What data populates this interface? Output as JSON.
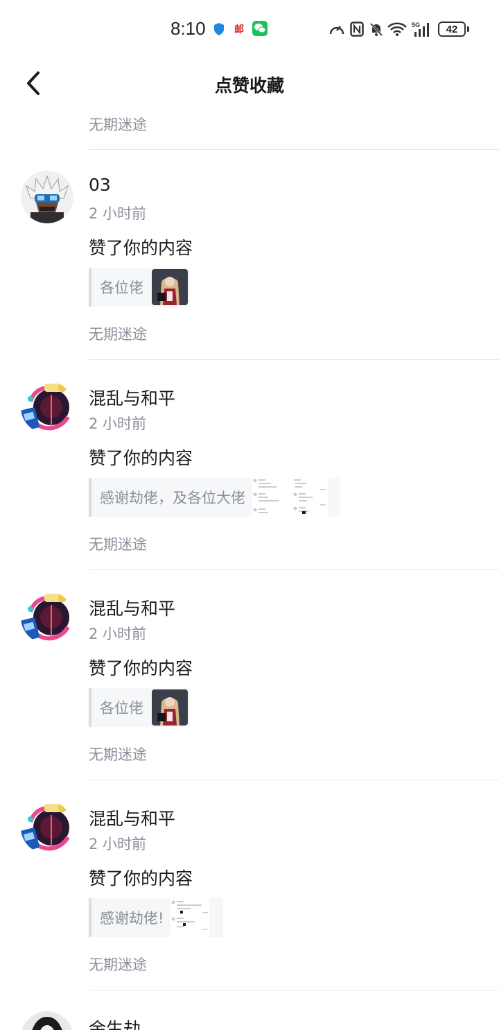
{
  "status_bar": {
    "time": "8:10",
    "mail_app_label": "邮",
    "battery_level": "42",
    "network": "5G",
    "icons": [
      "shield-icon",
      "mail-app-icon",
      "wechat-icon",
      "speed-icon",
      "nfc-icon",
      "bell-off-icon",
      "wifi-icon",
      "signal-icon",
      "battery-icon"
    ]
  },
  "header": {
    "title": "点赞收藏",
    "back_icon": "chevron-left-icon"
  },
  "first_source": "无期迷途",
  "items": [
    {
      "user": "03",
      "time": "2 小时前",
      "action": "赞了你的内容",
      "quote": "各位佬",
      "attachment": "image",
      "source": "无期迷途"
    },
    {
      "user": "混乱与和平",
      "time": "2 小时前",
      "action": "赞了你的内容",
      "quote": "感谢劫佬，及各位大佬",
      "attachment": "screenshot",
      "source": "无期迷途"
    },
    {
      "user": "混乱与和平",
      "time": "2 小时前",
      "action": "赞了你的内容",
      "quote": "各位佬",
      "attachment": "image",
      "source": "无期迷途"
    },
    {
      "user": "混乱与和平",
      "time": "2 小时前",
      "action": "赞了你的内容",
      "quote": "感谢劫佬!",
      "attachment": "screenshot",
      "source": "无期迷途"
    },
    {
      "user": "余生劫"
    }
  ]
}
